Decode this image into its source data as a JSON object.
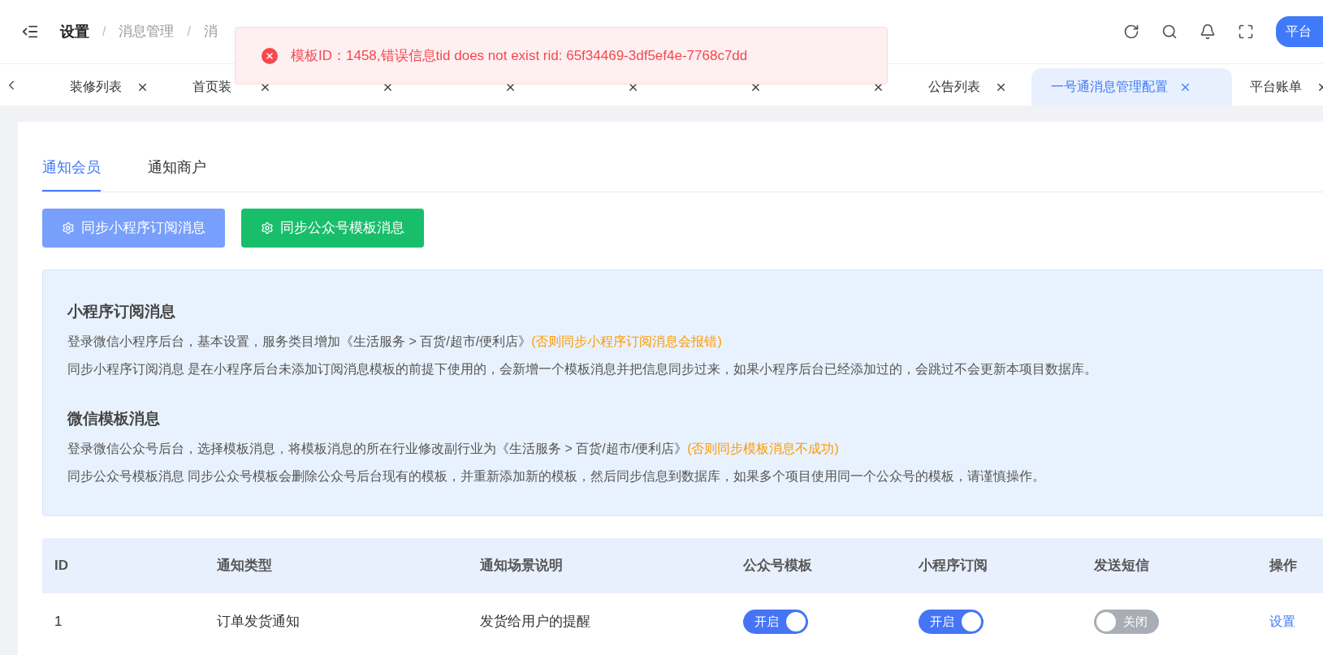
{
  "header": {
    "title": "设置",
    "separator": "/",
    "breadcrumb": [
      "消息管理",
      "消"
    ],
    "platform_button": "平台"
  },
  "toast": {
    "kind": "error",
    "message": "模板ID：1458,错误信息tid does not exist rid: 65f34469-3df5ef4e-7768c7dd"
  },
  "tabs": [
    {
      "label": "装修列表",
      "selected": false
    },
    {
      "label": "首页装",
      "selected": false
    },
    {
      "selected": false
    },
    {
      "selected": false
    },
    {
      "selected": false
    },
    {
      "selected": false
    },
    {
      "selected": false
    },
    {
      "label": "公告列表",
      "selected": false
    },
    {
      "label": "一号通消息管理配置",
      "selected": true
    },
    {
      "label": "平台账单",
      "selected": false
    }
  ],
  "sub_tabs": [
    {
      "label": "通知会员",
      "selected": true
    },
    {
      "label": "通知商户",
      "selected": false
    }
  ],
  "buttons": [
    {
      "label": "同步小程序订阅消息",
      "kind": "primary"
    },
    {
      "label": "同步公众号模板消息",
      "kind": "success"
    }
  ],
  "info": [
    {
      "title": "小程序订阅消息",
      "lines": [
        {
          "text": "登录微信小程序后台，基本设置，服务类目增加《生活服务 > 百货/超市/便利店》",
          "note": "(否则同步小程序订阅消息会报错)"
        },
        {
          "text": "同步小程序订阅消息 是在小程序后台未添加订阅消息模板的前提下使用的，会新增一个模板消息并把信息同步过来，如果小程序后台已经添加过的，会跳过不会更新本项目数据库。"
        }
      ]
    },
    {
      "title": "微信模板消息",
      "lines": [
        {
          "text": "登录微信公众号后台，选择模板消息，将模板消息的所在行业修改副行业为《生活服务 > 百货/超市/便利店》",
          "note": "(否则同步模板消息不成功)"
        },
        {
          "text": "同步公众号模板消息 同步公众号模板会删除公众号后台现有的模板，并重新添加新的模板，然后同步信息到数据库，如果多个项目使用同一个公众号的模板，请谨慎操作。"
        }
      ]
    }
  ],
  "table": {
    "columns": [
      "ID",
      "通知类型",
      "通知场景说明",
      "公众号模板",
      "小程序订阅",
      "发送短信",
      "操作"
    ],
    "rows": [
      {
        "id": "1",
        "type": "订单发货通知",
        "description": "发货给用户的提醒",
        "switches": [
          {
            "on": true,
            "label": "开启"
          },
          {
            "on": true,
            "label": "开启"
          },
          {
            "on": false,
            "label": "关闭"
          }
        ],
        "action": "设置"
      }
    ]
  }
}
